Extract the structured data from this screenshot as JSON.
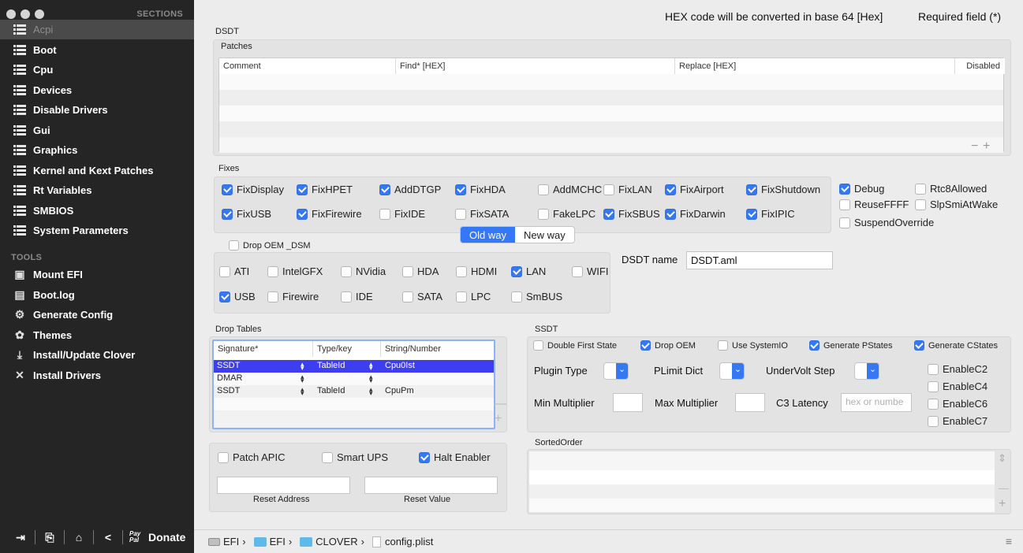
{
  "sidebar": {
    "sections_header": "SECTIONS",
    "tools_header": "TOOLS",
    "sections": [
      {
        "label": "Acpi",
        "icon": "list-icon",
        "selected": true
      },
      {
        "label": "Boot",
        "icon": "list-icon"
      },
      {
        "label": "Cpu",
        "icon": "list-icon"
      },
      {
        "label": "Devices",
        "icon": "list-icon"
      },
      {
        "label": "Disable Drivers",
        "icon": "list-icon"
      },
      {
        "label": "Gui",
        "icon": "list-icon"
      },
      {
        "label": "Graphics",
        "icon": "list-icon"
      },
      {
        "label": "Kernel and Kext Patches",
        "icon": "list-icon"
      },
      {
        "label": "Rt Variables",
        "icon": "list-icon"
      },
      {
        "label": "SMBIOS",
        "icon": "list-icon"
      },
      {
        "label": "System Parameters",
        "icon": "list-icon"
      }
    ],
    "tools": [
      {
        "label": "Mount EFI",
        "icon": "disk-icon"
      },
      {
        "label": "Boot.log",
        "icon": "log-icon"
      },
      {
        "label": "Generate Config",
        "icon": "gear-icon"
      },
      {
        "label": "Themes",
        "icon": "palette-icon"
      },
      {
        "label": "Install/Update Clover",
        "icon": "download-icon"
      },
      {
        "label": "Install Drivers",
        "icon": "tools-icon"
      }
    ],
    "bottom": {
      "paypal_mark": "Pay Pal",
      "donate_label": "Donate"
    }
  },
  "header": {
    "hex_note": "HEX code will be converted in base 64 [Hex]",
    "required_note": "Required field (*)"
  },
  "dsdt": {
    "title": "DSDT",
    "patches_label": "Patches",
    "patches_columns": [
      "Comment",
      "Find* [HEX]",
      "Replace [HEX]",
      "Disabled"
    ],
    "fixes_label": "Fixes",
    "fixes": [
      {
        "label": "FixDisplay",
        "checked": true
      },
      {
        "label": "FixHPET",
        "checked": true
      },
      {
        "label": "AddDTGP",
        "checked": true
      },
      {
        "label": "FixHDA",
        "checked": true
      },
      {
        "label": "AddMCHC",
        "checked": false
      },
      {
        "label": "FixLAN",
        "checked": false
      },
      {
        "label": "FixAirport",
        "checked": true
      },
      {
        "label": "FixShutdown",
        "checked": true
      },
      {
        "label": "FixUSB",
        "checked": true
      },
      {
        "label": "FixFirewire",
        "checked": true
      },
      {
        "label": "FixIDE",
        "checked": false
      },
      {
        "label": "FixSATA",
        "checked": false
      },
      {
        "label": "FakeLPC",
        "checked": false
      },
      {
        "label": "FixSBUS",
        "checked": true
      },
      {
        "label": "FixDarwin",
        "checked": true
      },
      {
        "label": "FixIPIC",
        "checked": true
      }
    ],
    "side_fixes": [
      {
        "label": "Debug",
        "checked": true
      },
      {
        "label": "Rtc8Allowed",
        "checked": false
      },
      {
        "label": "ReuseFFFF",
        "checked": false
      },
      {
        "label": "SlpSmiAtWake",
        "checked": false
      },
      {
        "label": "SuspendOverride",
        "checked": false
      }
    ],
    "mode_options": [
      "Old way",
      "New way"
    ],
    "mode_selected": "Old way",
    "drop_oem_dsm_label": "Drop OEM _DSM",
    "drop_oem_dsm": [
      {
        "label": "ATI",
        "checked": false
      },
      {
        "label": "IntelGFX",
        "checked": false
      },
      {
        "label": "NVidia",
        "checked": false
      },
      {
        "label": "HDA",
        "checked": false
      },
      {
        "label": "HDMI",
        "checked": false
      },
      {
        "label": "LAN",
        "checked": true
      },
      {
        "label": "WIFI",
        "checked": false
      },
      {
        "label": "USB",
        "checked": true
      },
      {
        "label": "Firewire",
        "checked": false
      },
      {
        "label": "IDE",
        "checked": false
      },
      {
        "label": "SATA",
        "checked": false
      },
      {
        "label": "LPC",
        "checked": false
      },
      {
        "label": "SmBUS",
        "checked": false
      }
    ],
    "dsdt_name_label": "DSDT name",
    "dsdt_name_value": "DSDT.aml"
  },
  "drop_tables": {
    "label": "Drop Tables",
    "columns": [
      "Signature*",
      "Type/key",
      "String/Number"
    ],
    "rows": [
      {
        "signature": "SSDT",
        "type": "TableId",
        "value": "Cpu0Ist",
        "selected": true
      },
      {
        "signature": "DMAR",
        "type": "",
        "value": "",
        "selected": false
      },
      {
        "signature": "SSDT",
        "type": "TableId",
        "value": "CpuPm",
        "selected": false
      }
    ]
  },
  "misc": {
    "patch_apic": {
      "label": "Patch APIC",
      "checked": false
    },
    "smart_ups": {
      "label": "Smart UPS",
      "checked": false
    },
    "halt_enabler": {
      "label": "Halt Enabler",
      "checked": true
    },
    "reset_address_label": "Reset Address",
    "reset_value_label": "Reset Value",
    "reset_address_value": "",
    "reset_value_value": ""
  },
  "ssdt": {
    "title": "SSDT",
    "options": [
      {
        "label": "Double First State",
        "checked": false
      },
      {
        "label": "Drop OEM",
        "checked": true
      },
      {
        "label": "Use SystemIO",
        "checked": false
      },
      {
        "label": "Generate PStates",
        "checked": true
      },
      {
        "label": "Generate CStates",
        "checked": true
      }
    ],
    "plugin_type_label": "Plugin Type",
    "plimit_dict_label": "PLimit Dict",
    "undervolt_step_label": "UnderVolt Step",
    "min_multiplier_label": "Min Multiplier",
    "max_multiplier_label": "Max Multiplier",
    "c3_latency_label": "C3 Latency",
    "c3_latency_placeholder": "hex or numbe",
    "c_states": [
      {
        "label": "EnableC2",
        "checked": false
      },
      {
        "label": "EnableC4",
        "checked": false
      },
      {
        "label": "EnableC6",
        "checked": false
      },
      {
        "label": "EnableC7",
        "checked": false
      }
    ]
  },
  "sorted_order": {
    "label": "SortedOrder"
  },
  "pathbar": {
    "items": [
      "EFI",
      "EFI",
      "CLOVER",
      "config.plist"
    ],
    "separator": "›"
  },
  "colors": {
    "accent": "#3478f6",
    "sidebar_bg": "#252525",
    "selection": "#3d3ef0"
  }
}
